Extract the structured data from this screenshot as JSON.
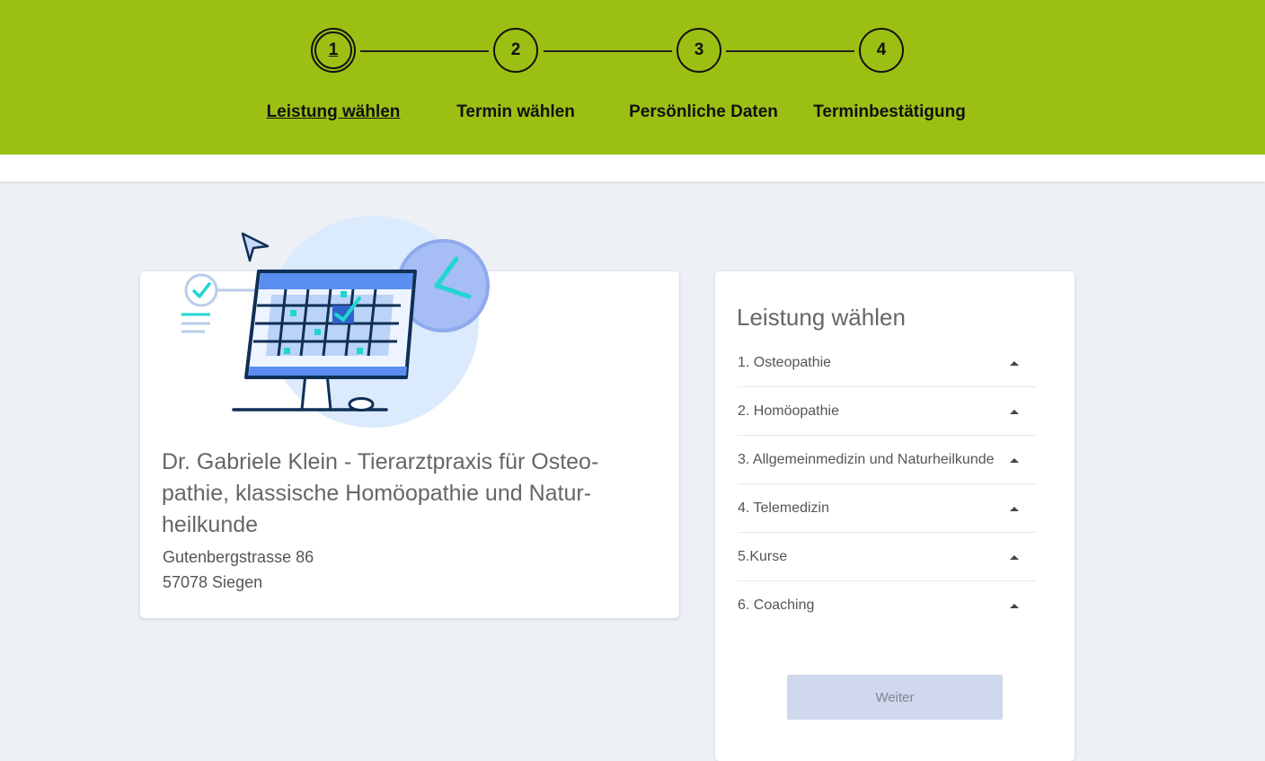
{
  "stepper": {
    "steps": [
      {
        "number": "1",
        "label": "Leistung wählen"
      },
      {
        "number": "2",
        "label": "Termin wählen"
      },
      {
        "number": "3",
        "label": "Persönliche Daten"
      },
      {
        "number": "4",
        "label": "Terminbestätigung"
      }
    ],
    "active_step": 1
  },
  "practice": {
    "title": "Dr. Gabriele Klein - Tierarztpraxis für Osteo-pathie, klassische Homöopathie und Natur-heilkunde",
    "street": "Gutenbergstrasse 86",
    "city": "57078 Siegen"
  },
  "services_panel": {
    "title": "Leistung wählen",
    "items": [
      {
        "label": "1. Osteopathie"
      },
      {
        "label": "2. Homöopathie"
      },
      {
        "label": "3. Allgemeinmedizin und Naturheilkunde"
      },
      {
        "label": "4. Telemedizin"
      },
      {
        "label": "5.Kurse"
      },
      {
        "label": "6. Coaching"
      }
    ],
    "next_button": "Weiter"
  },
  "colors": {
    "header_green": "#9bc013",
    "page_bg": "#edf1f5",
    "button_disabled": "#cfd8ec",
    "illustration_teal": "#1fd6d0",
    "illustration_navy": "#0f2f55"
  }
}
